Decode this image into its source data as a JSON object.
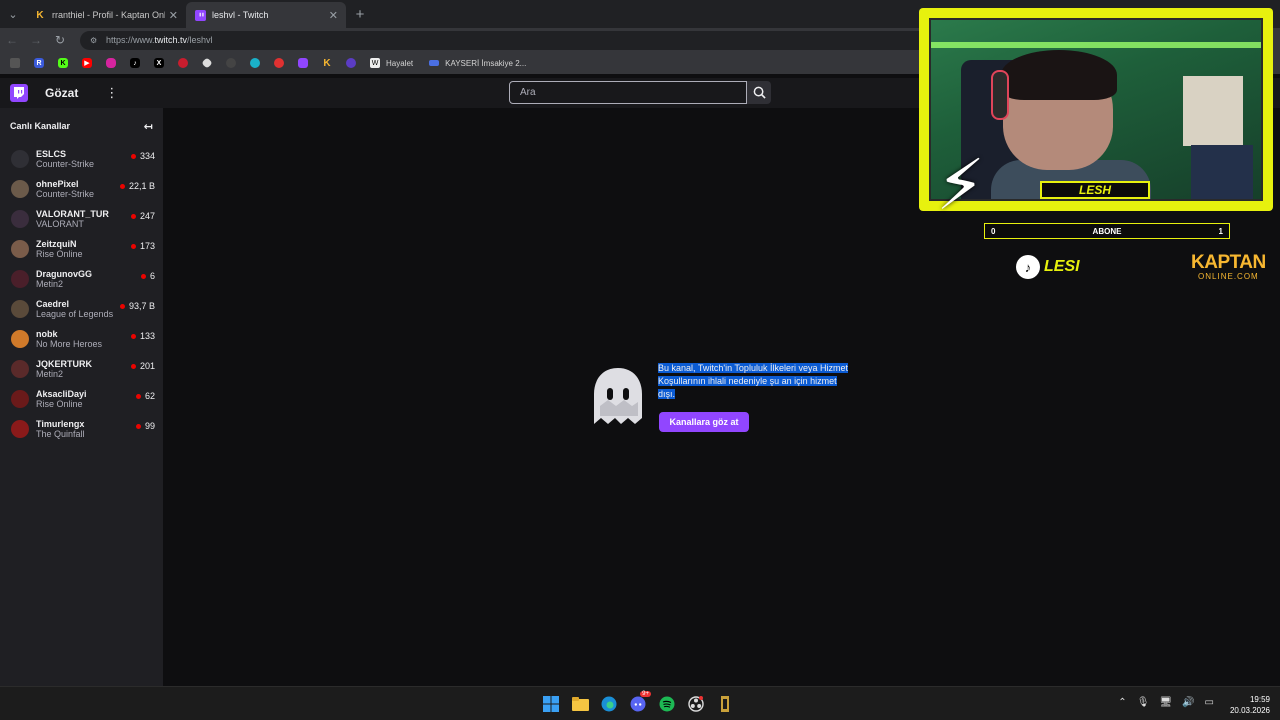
{
  "browser": {
    "tabs": [
      {
        "title": "rranthiel - Profil - Kaptan Online",
        "favicon": "K",
        "active": false
      },
      {
        "title": "leshvl - Twitch",
        "favicon": "twitch",
        "active": true
      }
    ],
    "url_prefix": "https://www.",
    "url_host": "twitch.tv",
    "url_path": "/leshvl",
    "bookmarks": [
      {
        "label": "Hayalet"
      },
      {
        "label": "KAYSERİ İmsakiye 2..."
      }
    ]
  },
  "twitch": {
    "browse_label": "Gözat",
    "search_placeholder": "Ara",
    "sidebar": {
      "heading": "Canlı Kanallar",
      "channels": [
        {
          "name": "ESLCS",
          "game": "Counter-Strike",
          "viewers": "334",
          "color": "#2f2f35"
        },
        {
          "name": "ohnePixel",
          "game": "Counter-Strike",
          "viewers": "22,1 B",
          "color": "#6b5a4a"
        },
        {
          "name": "VALORANT_TUR",
          "game": "VALORANT",
          "viewers": "247",
          "color": "#3a2d3d"
        },
        {
          "name": "ZeitzquiN",
          "game": "Rise Online",
          "viewers": "173",
          "color": "#7a5c4a"
        },
        {
          "name": "DragunovGG",
          "game": "Metin2",
          "viewers": "6",
          "color": "#4a1f2a"
        },
        {
          "name": "Caedrel",
          "game": "League of Legends",
          "viewers": "93,7 B",
          "color": "#5a4a3a"
        },
        {
          "name": "nobk",
          "game": "No More Heroes",
          "viewers": "133",
          "color": "#d07a2a"
        },
        {
          "name": "JQKERTURK",
          "game": "Metin2",
          "viewers": "201",
          "color": "#5a2a2a"
        },
        {
          "name": "AksacliDayi",
          "game": "Rise Online",
          "viewers": "62",
          "color": "#6a1a1a"
        },
        {
          "name": "Timurlengx",
          "game": "The Quinfall",
          "viewers": "99",
          "color": "#8a1a1a"
        }
      ]
    },
    "unavailable_message": "Bu kanal, Twitch'in Topluluk İlkeleri veya Hizmet Koşullarının ihlali nedeniyle şu an için hizmet dışı.",
    "browse_channels_button": "Kanallara göz at"
  },
  "overlay": {
    "streamer_name": "LESH",
    "sub_label": "ABONE",
    "sub_left": "0",
    "sub_right": "1",
    "tiktok_handle": "LESI",
    "sponsor_main": "KAPTAN",
    "sponsor_sub": "ONLINE.COM"
  },
  "taskbar": {
    "time": "19:59",
    "date": "20.03.2026",
    "discord_badge": "9+"
  },
  "colors": {
    "twitch_purple": "#9146ff",
    "overlay_yellow": "#e7f10e",
    "live_red": "#eb0400",
    "selection_blue": "#0b5bd3"
  }
}
